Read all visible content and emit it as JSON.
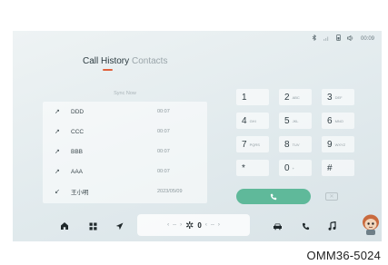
{
  "status_bar": {
    "icons": [
      "bluetooth-icon",
      "signal-icon",
      "phone-status-icon",
      "volume-icon"
    ],
    "time": "00:09"
  },
  "tabs": [
    {
      "label": "Call History",
      "active": true
    },
    {
      "label": "Contacts",
      "active": false
    }
  ],
  "call_list": {
    "header": "Sync Now",
    "rows": [
      {
        "direction": "outgoing",
        "arrow": "↗",
        "name": "DDD",
        "time": "00:07"
      },
      {
        "direction": "outgoing",
        "arrow": "↗",
        "name": "CCC",
        "time": "00:07"
      },
      {
        "direction": "outgoing",
        "arrow": "↗",
        "name": "BBB",
        "time": "00:07"
      },
      {
        "direction": "outgoing",
        "arrow": "↗",
        "name": "AAA",
        "time": "00:07"
      },
      {
        "direction": "incoming",
        "arrow": "↙",
        "name": "王小明",
        "time": "2023/05/09"
      }
    ]
  },
  "keypad": {
    "keys": [
      {
        "num": "1",
        "sub": ""
      },
      {
        "num": "2",
        "sub": "ABC"
      },
      {
        "num": "3",
        "sub": "DEF"
      },
      {
        "num": "4",
        "sub": "GHI"
      },
      {
        "num": "5",
        "sub": "JKL"
      },
      {
        "num": "6",
        "sub": "MNO"
      },
      {
        "num": "7",
        "sub": "PQRS"
      },
      {
        "num": "8",
        "sub": "TUV"
      },
      {
        "num": "9",
        "sub": "WXYZ"
      },
      {
        "num": "*",
        "sub": ""
      },
      {
        "num": "0",
        "sub": "+"
      },
      {
        "num": "#",
        "sub": ""
      }
    ],
    "call_button_icon": "phone-call-icon",
    "delete_button_icon": "backspace-icon"
  },
  "dock": {
    "left_icons": [
      "home-icon",
      "apps-icon",
      "navigation-icon"
    ],
    "climate": {
      "left_temp": "--",
      "right_temp": "--",
      "fan_level": "0"
    },
    "right_icons": [
      "car-icon",
      "phone-icon",
      "music-icon"
    ]
  },
  "colors": {
    "accent": "#e0613c",
    "call_green": "#5fb99a"
  },
  "caption": "OMM36-5024"
}
